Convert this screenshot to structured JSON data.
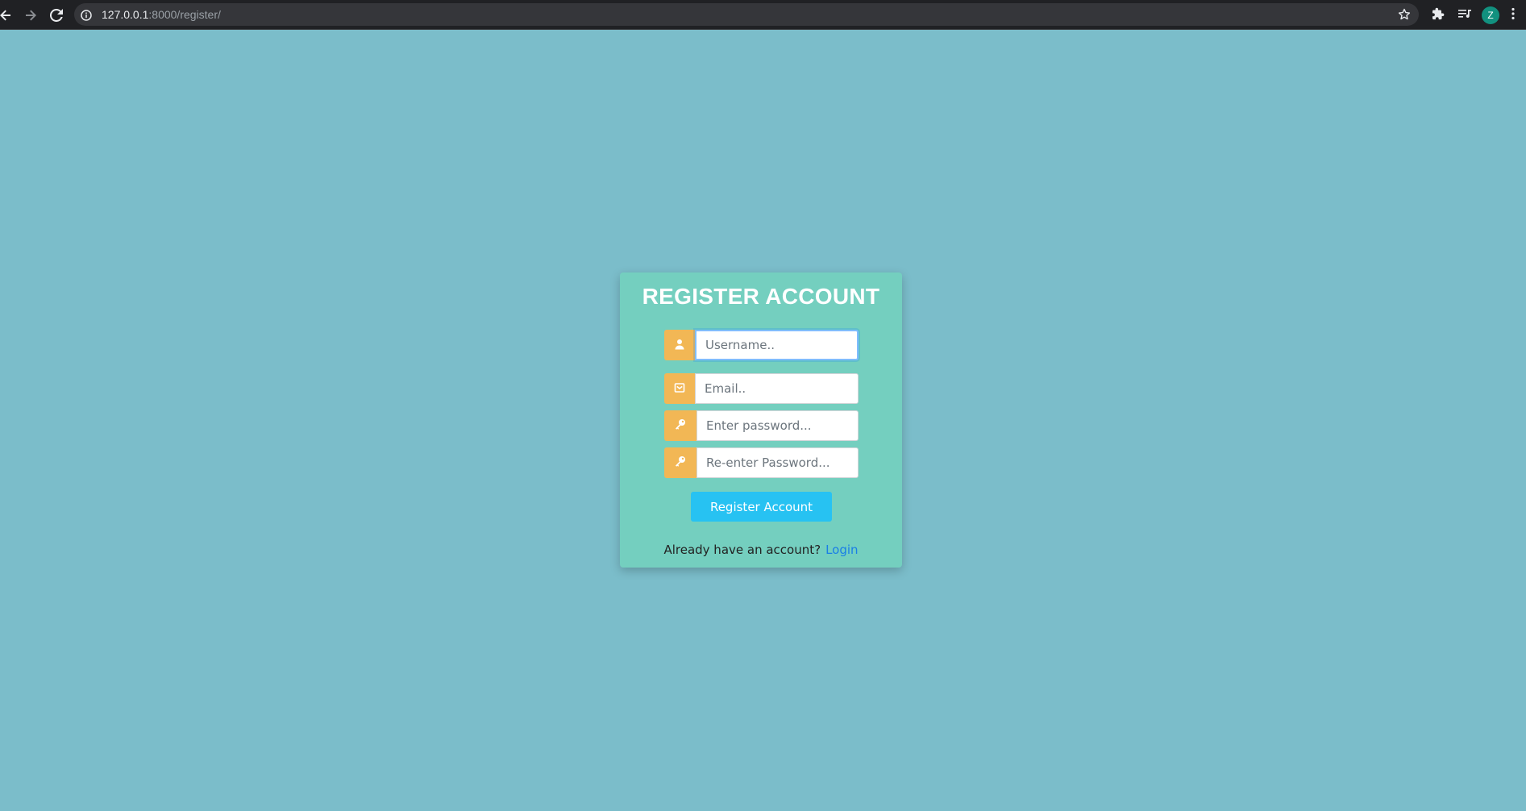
{
  "browser": {
    "url_host": "127.0.0.1",
    "url_path": ":8000/register/",
    "profile_initial": "Z",
    "icons": {
      "back": "arrow-left-icon",
      "forward": "arrow-right-icon",
      "reload": "reload-icon",
      "site_info": "info-icon",
      "bookmark": "star-icon",
      "extensions": "puzzle-icon",
      "media": "playlist-icon",
      "menu": "kebab-menu-icon"
    }
  },
  "colors": {
    "page_background": "#7bbdca",
    "card_background": "#74cfbf",
    "addon_background": "#f2b755",
    "button_background": "#27c2f2",
    "link": "#1a7fe6",
    "avatar_background": "#12917f"
  },
  "form": {
    "title": "REGISTER ACCOUNT",
    "username_placeholder": "Username..",
    "email_placeholder": "Email..",
    "password_placeholder": "Enter password...",
    "confirm_password_placeholder": "Re-enter Password...",
    "submit_label": "Register Account",
    "footer_text": "Already have an account?",
    "login_label": "Login",
    "icons": {
      "username": "user-icon",
      "email": "envelope-icon",
      "password": "key-icon",
      "confirm_password": "key-icon"
    }
  }
}
